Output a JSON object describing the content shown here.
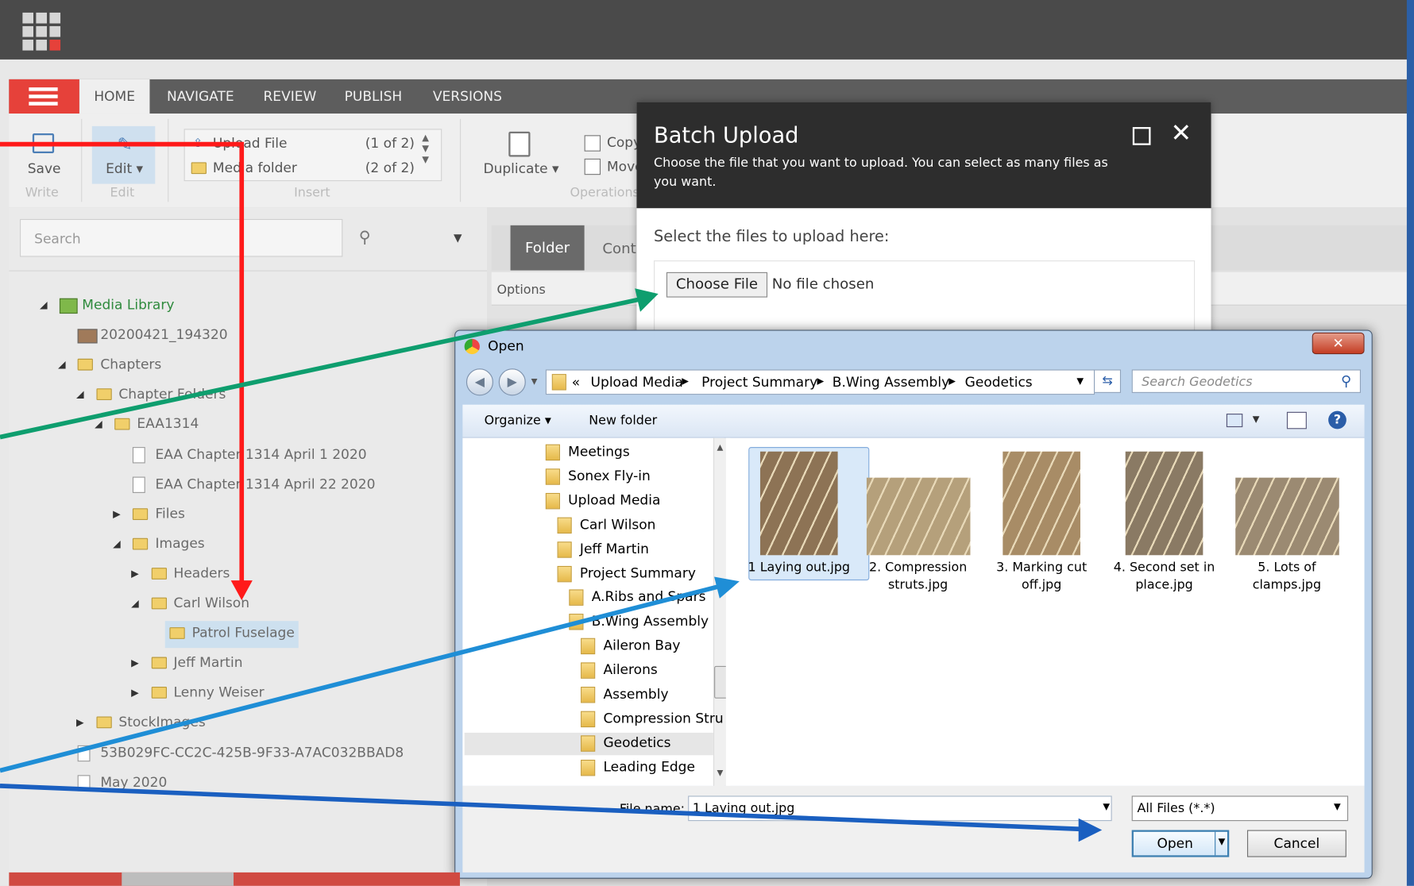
{
  "tabs": [
    "HOME",
    "NAVIGATE",
    "REVIEW",
    "PUBLISH",
    "VERSIONS"
  ],
  "ribbon": {
    "save": "Save",
    "write": "Write",
    "edit": "Edit ▾",
    "edit_group": "Edit",
    "upload_file": "Upload File",
    "upload_file_count": "(1 of 2)",
    "media_folder": "Media folder",
    "media_folder_count": "(2 of 2)",
    "insert_group": "Insert",
    "duplicate": "Duplicate ▾",
    "copy": "Copy",
    "move": "Move",
    "operations_group": "Operations"
  },
  "search": {
    "placeholder": "Search"
  },
  "tree": [
    {
      "label": "Media Library",
      "indent": 0,
      "icon": "media-library-icon",
      "tri": "◢"
    },
    {
      "label": "20200421_194320",
      "indent": 1,
      "icon": "image-icon",
      "tri": ""
    },
    {
      "label": "Chapters",
      "indent": 1,
      "icon": "folder-icon",
      "tri": "◢"
    },
    {
      "label": "Chapter Folders",
      "indent": 2,
      "icon": "folder-icon",
      "tri": "◢"
    },
    {
      "label": "EAA1314",
      "indent": 3,
      "icon": "folder-icon",
      "tri": "◢"
    },
    {
      "label": "EAA Chapter 1314 April 1 2020",
      "indent": 4,
      "icon": "document-icon",
      "tri": ""
    },
    {
      "label": "EAA Chapter 1314 April 22 2020",
      "indent": 4,
      "icon": "document-icon",
      "tri": ""
    },
    {
      "label": "Files",
      "indent": 4,
      "icon": "folder-icon",
      "tri": "▶"
    },
    {
      "label": "Images",
      "indent": 4,
      "icon": "folder-icon",
      "tri": "◢"
    },
    {
      "label": "Headers",
      "indent": 5,
      "icon": "folder-icon",
      "tri": "▶"
    },
    {
      "label": "Carl Wilson",
      "indent": 5,
      "icon": "folder-icon",
      "tri": "◢"
    },
    {
      "label": "Patrol Fuselage",
      "indent": 6,
      "icon": "folder-icon",
      "tri": "",
      "selected": true
    },
    {
      "label": "Jeff Martin",
      "indent": 5,
      "icon": "folder-icon",
      "tri": "▶"
    },
    {
      "label": "Lenny Weiser",
      "indent": 5,
      "icon": "folder-icon",
      "tri": "▶"
    },
    {
      "label": "StockImages",
      "indent": 2,
      "icon": "folder-icon",
      "tri": "▶"
    },
    {
      "label": "53B029FC-CC2C-425B-9F33-A7AC032BBAD8",
      "indent": 1,
      "icon": "document-icon",
      "tri": ""
    },
    {
      "label": "May 2020",
      "indent": 1,
      "icon": "document-icon",
      "tri": ""
    }
  ],
  "content": {
    "folder_tab": "Folder",
    "content_tab": "Content",
    "options": "Options"
  },
  "batch": {
    "title": "Batch Upload",
    "description": "Choose the file that you want to upload. You can select as many files as you want.",
    "select_label": "Select the files to upload here:",
    "choose_button": "Choose File",
    "no_file": "No file chosen"
  },
  "open_dialog": {
    "title": "Open",
    "breadcrumb": [
      "Upload Media",
      "Project Summary",
      "B.Wing Assembly",
      "Geodetics"
    ],
    "search_placeholder": "Search Geodetics",
    "organize": "Organize ▾",
    "new_folder": "New folder",
    "nav_items": [
      {
        "label": "Meetings",
        "indent": 0
      },
      {
        "label": "Sonex Fly-in",
        "indent": 0
      },
      {
        "label": "Upload Media",
        "indent": 0
      },
      {
        "label": "Carl Wilson",
        "indent": 1
      },
      {
        "label": "Jeff Martin",
        "indent": 1
      },
      {
        "label": "Project Summary",
        "indent": 1
      },
      {
        "label": "A.Ribs and Spars",
        "indent": 2
      },
      {
        "label": "B.Wing Assembly",
        "indent": 2
      },
      {
        "label": "Aileron Bay",
        "indent": 3
      },
      {
        "label": "Ailerons",
        "indent": 3
      },
      {
        "label": "Assembly",
        "indent": 3
      },
      {
        "label": "Compression Stru",
        "indent": 3
      },
      {
        "label": "Geodetics",
        "indent": 3,
        "selected": true
      },
      {
        "label": "Leading Edge",
        "indent": 3
      }
    ],
    "files": [
      {
        "name": "1 Laying out.jpg",
        "selected": true
      },
      {
        "name": "2. Compression struts.jpg"
      },
      {
        "name": "3. Marking cut off.jpg"
      },
      {
        "name": "4. Second set in place.jpg"
      },
      {
        "name": "5. Lots of clamps.jpg"
      }
    ],
    "file_name_label": "File name:",
    "file_name_value": "1 Laying out.jpg",
    "filter": "All Files (*.*)",
    "open_button": "Open",
    "cancel_button": "Cancel"
  },
  "colors": {
    "accent_red": "#e6413a",
    "arrow_red": "#ff1a1a",
    "arrow_green": "#0e9e6e",
    "arrow_blue": "#1f8ed6",
    "arrow_darkblue": "#1a5fc0"
  }
}
